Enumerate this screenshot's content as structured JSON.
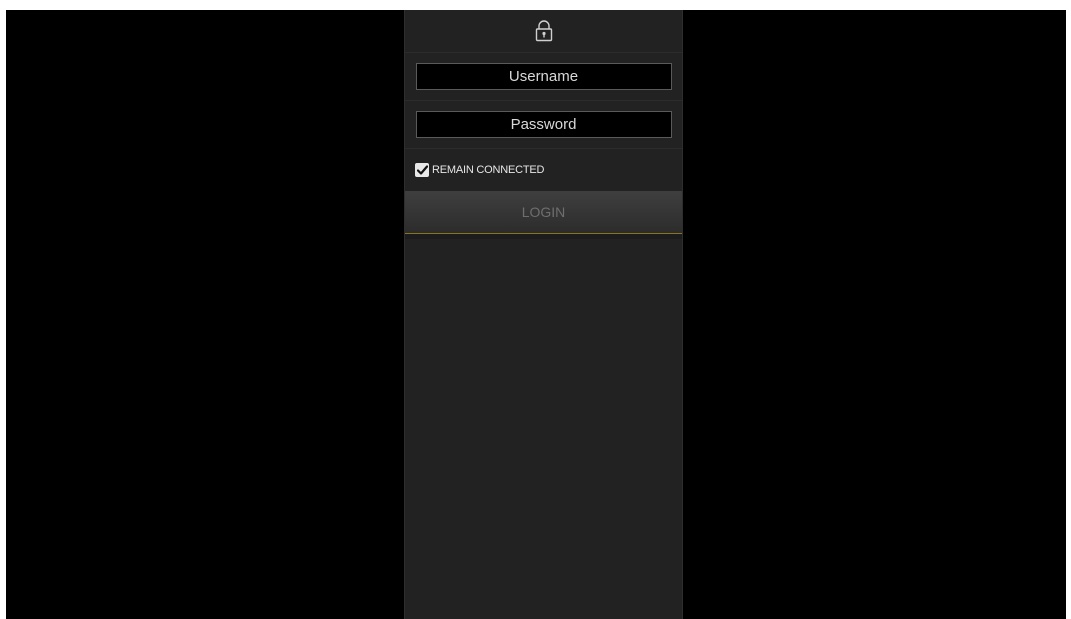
{
  "login_panel": {
    "lock_icon": "lock-icon",
    "username": {
      "placeholder": "Username",
      "value": ""
    },
    "password": {
      "placeholder": "Password",
      "value": ""
    },
    "remain_connected": {
      "label": "REMAIN CONNECTED",
      "checked": true
    },
    "login_label": "LOGIN"
  },
  "colors": {
    "background": "#000000",
    "panel": "#222222",
    "button_underline": "#8a7420"
  }
}
